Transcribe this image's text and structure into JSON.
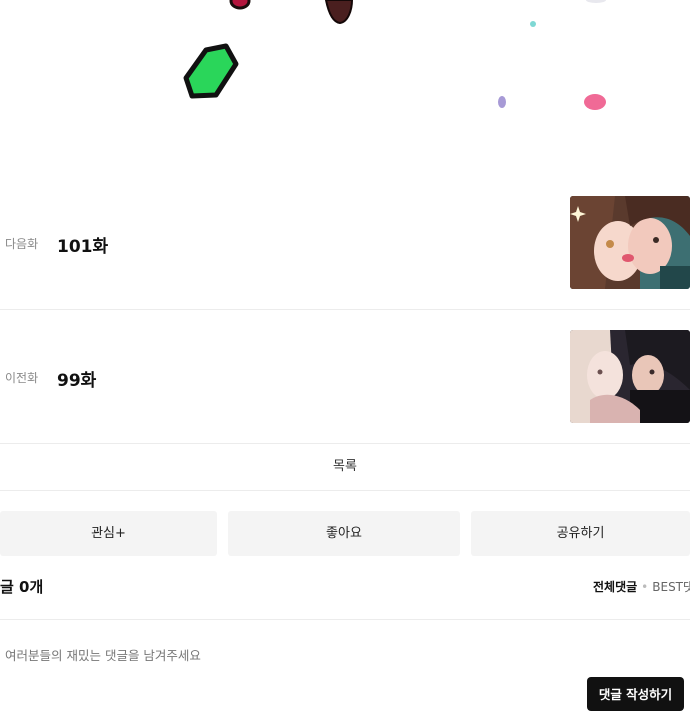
{
  "navigation": {
    "next": {
      "label": "다음화",
      "title": "101화"
    },
    "prev": {
      "label": "이전화",
      "title": "99화"
    }
  },
  "list_label": "목록",
  "actions": {
    "subscribe": "관심+",
    "like": "좋아요",
    "share": "공유하기"
  },
  "comments": {
    "count_text": "글 0개",
    "sort_all": "전체댓글",
    "sort_separator": "•",
    "sort_best": "BEST댓",
    "placeholder": "여러분들의 재밌는 댓글을 남겨주세요",
    "write_button": "댓글 작성하기"
  },
  "colors": {
    "write_button_bg": "#111111",
    "action_button_bg": "#f4f4f4"
  }
}
